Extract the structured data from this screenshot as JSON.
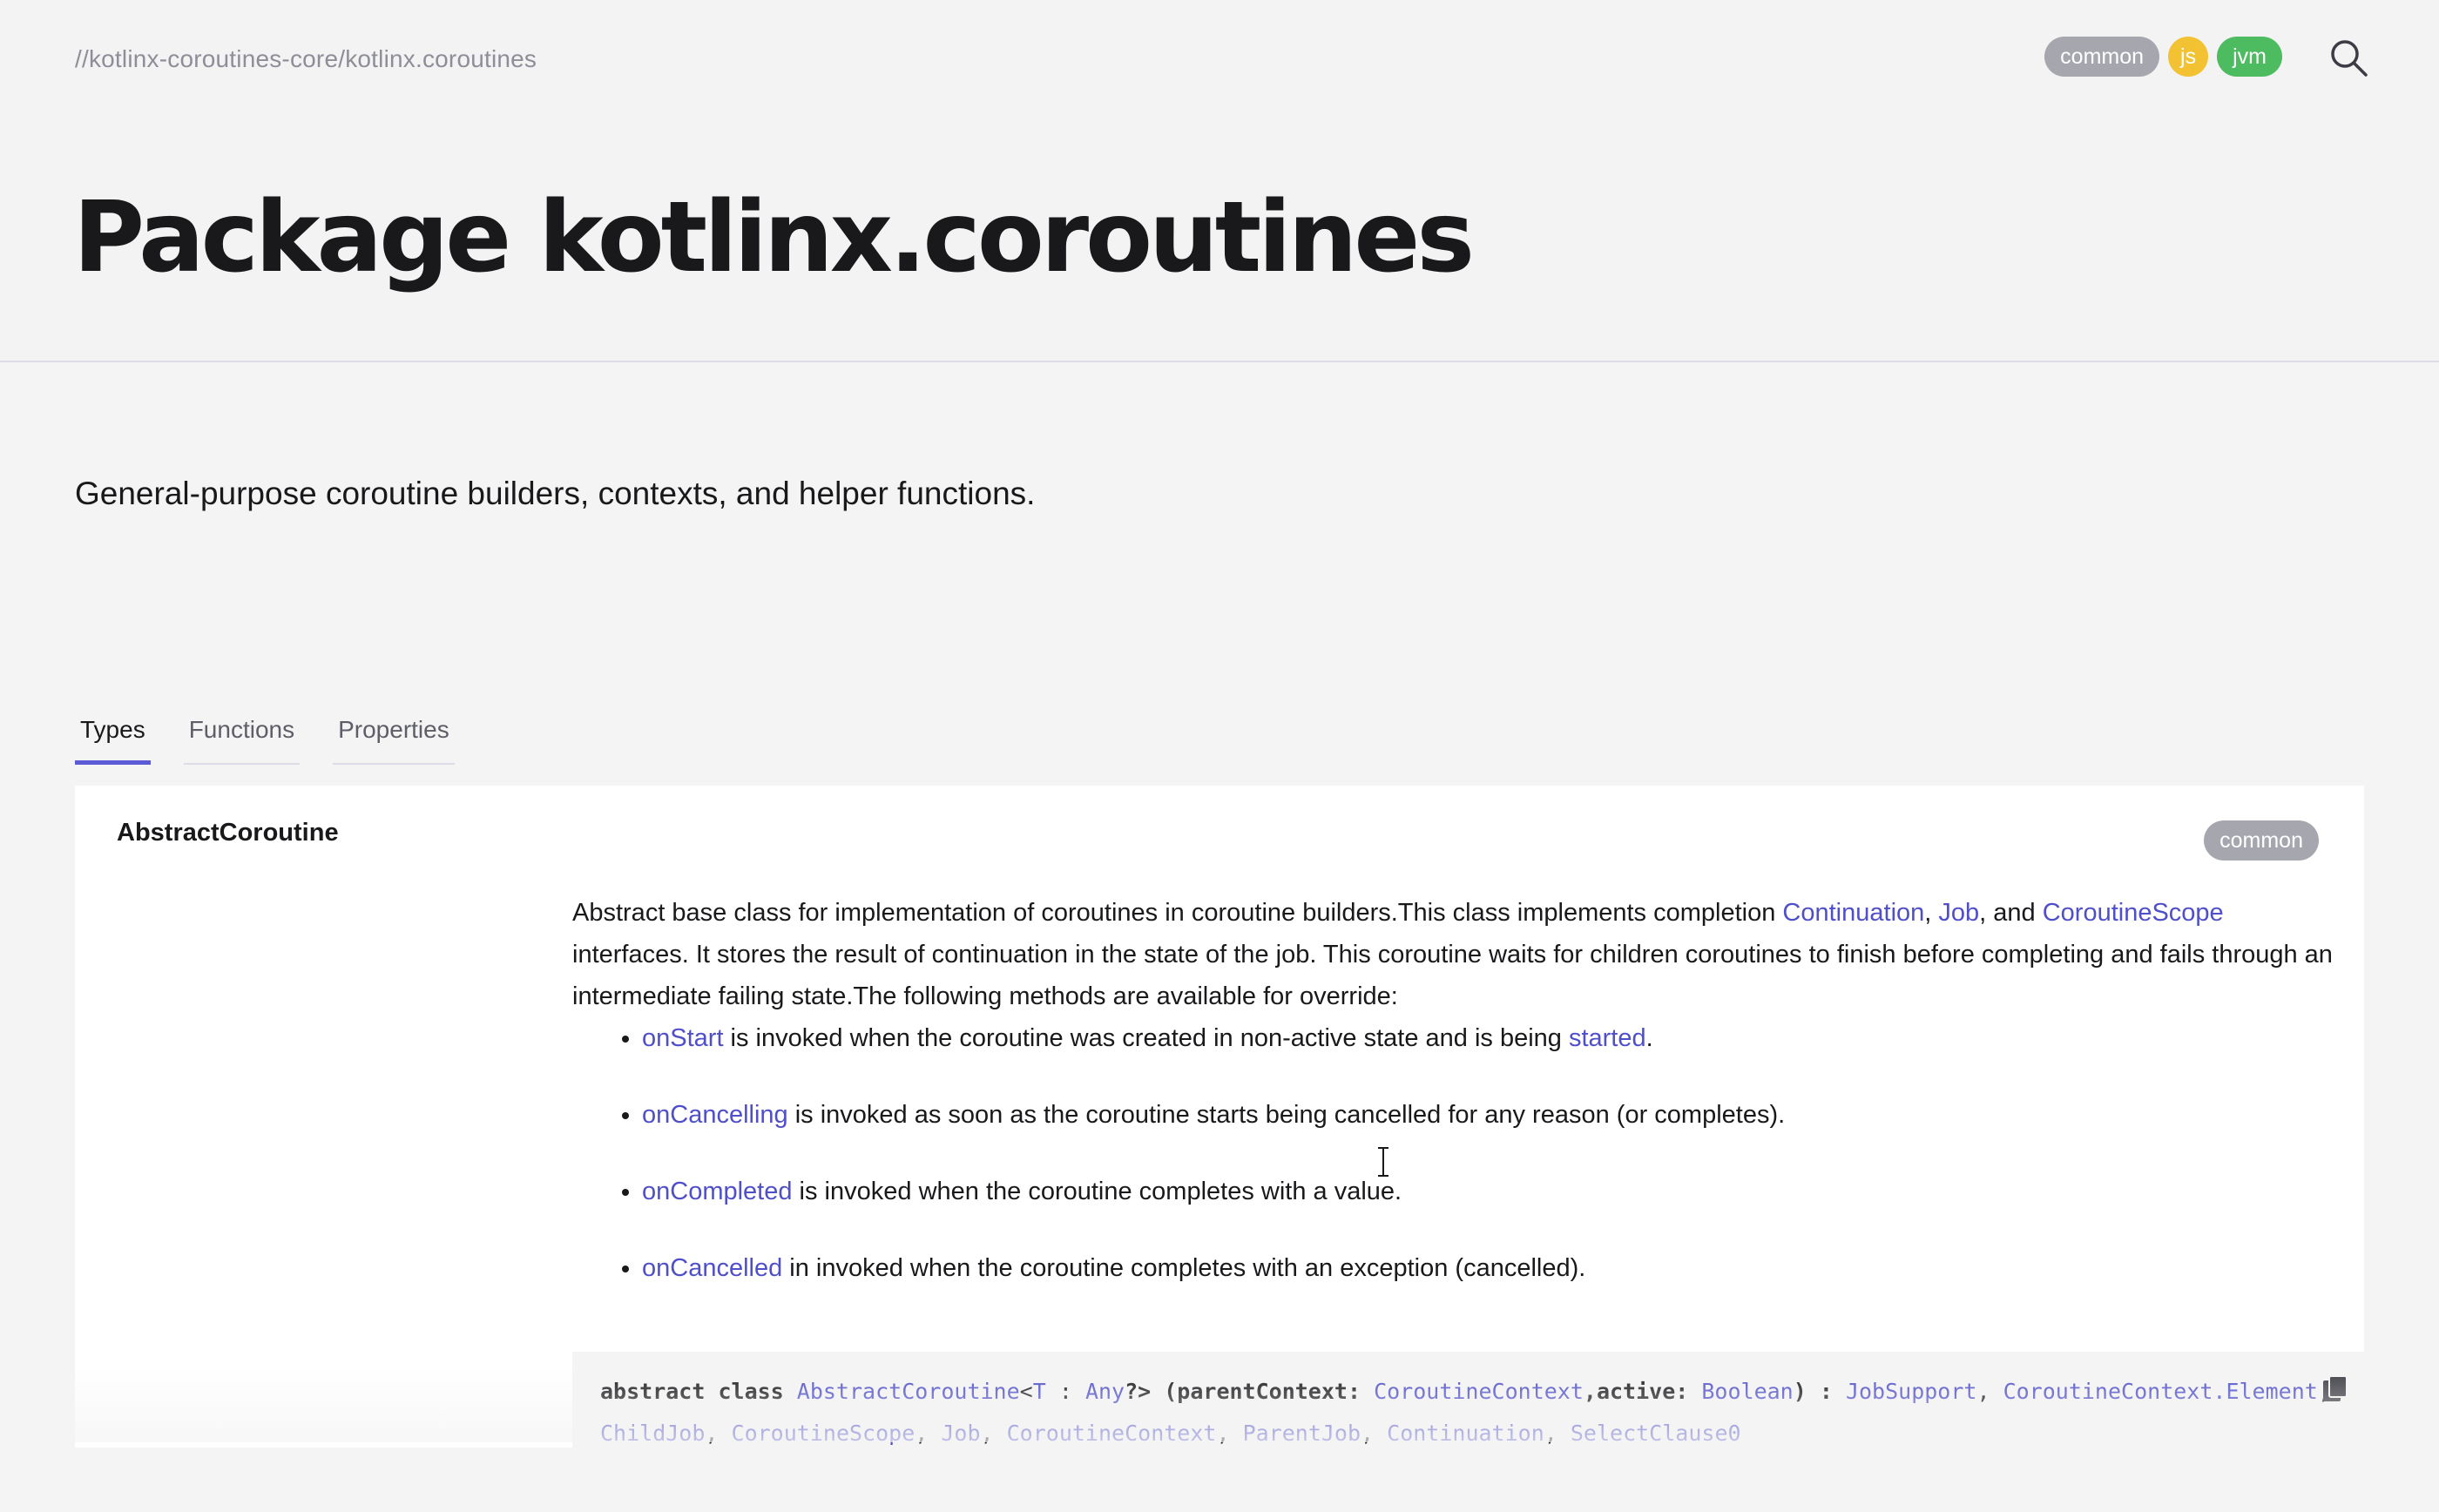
{
  "breadcrumb": "//kotlinx-coroutines-core/kotlinx.coroutines",
  "platforms": [
    "common",
    "js",
    "jvm"
  ],
  "page_title": "Package kotlinx.coroutines",
  "description": "General-purpose coroutine builders, contexts, and helper functions.",
  "tabs": [
    "Types",
    "Functions",
    "Properties"
  ],
  "active_tab": "Types",
  "card": {
    "title": "AbstractCoroutine",
    "platform_tag": "common",
    "intro": {
      "text_1": "Abstract base class for implementation of coroutines in coroutine builders.This class implements completion ",
      "link_1": "Continuation",
      "sep_1": ", ",
      "link_2": "Job",
      "sep_2": ", and ",
      "link_3": "CoroutineScope",
      "text_2": " interfaces. It stores the result of continuation in the state of the job. This coroutine waits for children coroutines to finish before completing and fails through an intermediate failing state.The following methods are available for override:"
    },
    "bullets": [
      {
        "link": "onStart",
        "text": " is invoked when the coroutine was created in non-active state and is being ",
        "link_2": "started",
        "end": "."
      },
      {
        "link": "onCancelling",
        "text": " is invoked as soon as the coroutine starts being cancelled for any reason (or completes)."
      },
      {
        "link": "onCompleted",
        "text": " is invoked when the coroutine completes with a value."
      },
      {
        "link": "onCancelled",
        "text": " in invoked when the coroutine completes with an exception (cancelled)."
      }
    ],
    "signature": {
      "kw_1": "abstract class ",
      "name": "AbstractCoroutine",
      "lt": "<",
      "type_param": "T",
      "colon_1": " : ",
      "any": "Any",
      "gt": "?> (parentContext: ",
      "param_type_1": "CoroutineContext",
      "active": ",active: ",
      "param_type_2": "Boolean",
      "close": ") : ",
      "super_1": "JobSupport",
      "comma_1": ", ",
      "super_2": "CoroutineContext.Element",
      "comma_2": ",",
      "line2": [
        "ChildJob",
        "CoroutineScope",
        "Job",
        "CoroutineContext",
        "ParentJob",
        "Continuation",
        "SelectClause0"
      ],
      "line2_sep": ", "
    }
  },
  "colors": {
    "link": "#4f4fc9",
    "tab_active": "#5b5bd6",
    "tag_common": "#a6a6af",
    "tag_js": "#f2c233",
    "tag_jvm": "#4dbb5f"
  }
}
